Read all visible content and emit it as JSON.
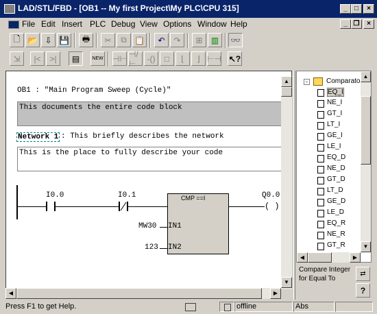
{
  "window": {
    "title": "LAD/STL/FBD - [OB1 -- My first Project\\My PLC\\CPU 315]"
  },
  "menu": [
    "File",
    "Edit",
    "Insert",
    "PLC",
    "Debug",
    "View",
    "Options",
    "Window",
    "Help"
  ],
  "editor": {
    "header": "OB1 :  \"Main Program Sweep (Cycle)\"",
    "block_comment": "This documents the entire code block",
    "network_label": "Network 1",
    "network_title": ": This briefly describes the network",
    "network_comment": "This is the place to fully describe your code",
    "contact1": "I0.0",
    "contact2": "I0.1",
    "box_title": "CMP ==I",
    "in1_operand": "MW30",
    "in1_pin": "IN1",
    "in2_operand": "123",
    "in2_pin": "IN2",
    "coil": "Q0.0"
  },
  "tree": {
    "folder": "Comparator",
    "items": [
      "EQ_I",
      "NE_I",
      "GT_I",
      "LT_I",
      "GE_I",
      "LE_I",
      "EQ_D",
      "NE_D",
      "GT_D",
      "LT_D",
      "GE_D",
      "LE_D",
      "EQ_R",
      "NE_R",
      "GT_R"
    ],
    "selected": "EQ_I",
    "description": "Compare Integer for Equal To"
  },
  "status": {
    "help": "Press F1 to get Help.",
    "mode": "offline",
    "abs": "Abs"
  }
}
